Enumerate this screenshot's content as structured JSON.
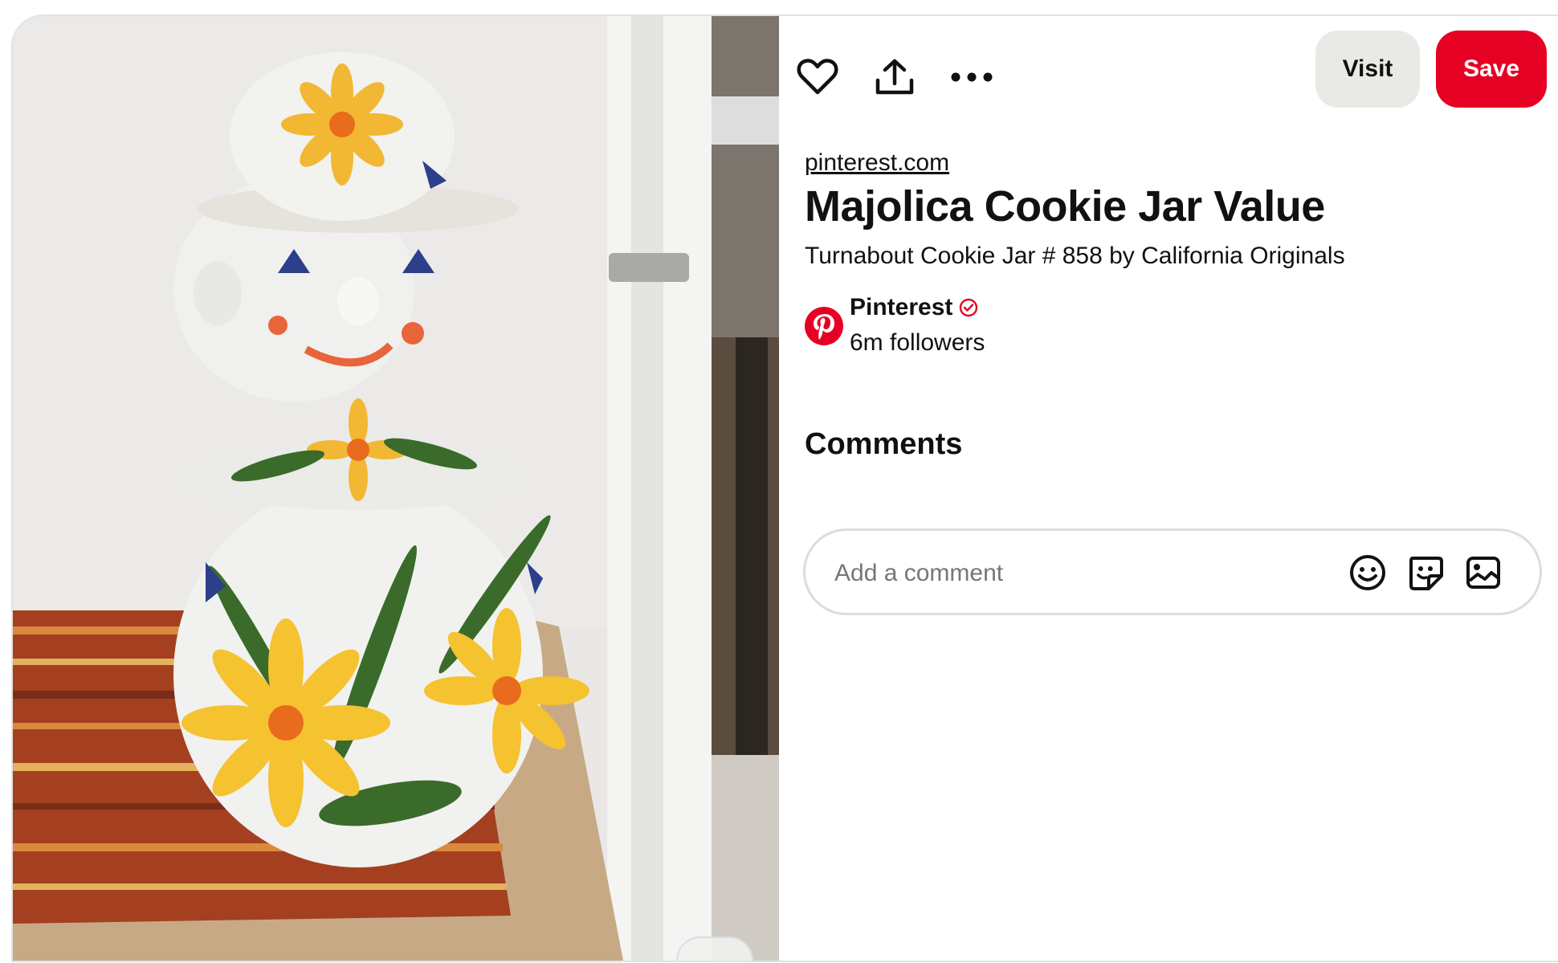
{
  "toolbar": {
    "like_icon": "heart-icon",
    "share_icon": "share-upload-icon",
    "more_icon": "ellipsis-icon",
    "visit_label": "Visit",
    "save_label": "Save"
  },
  "pin": {
    "source": "pinterest.com",
    "title": "Majolica Cookie Jar Value",
    "description": "Turnabout Cookie Jar # 858 by California Originals",
    "image_subject": "clown-cookie-jar-photo"
  },
  "creator": {
    "name": "Pinterest",
    "followers": "6m followers",
    "avatar_icon": "pinterest-logo-icon",
    "verified_icon": "verified-check-icon"
  },
  "comments": {
    "heading": "Comments",
    "placeholder": "Add a comment",
    "emoji_icon": "emoji-icon",
    "sticker_icon": "sticker-icon",
    "image_icon": "image-icon"
  },
  "colors": {
    "save_button": "#e60023",
    "visit_button": "#e9e9e6",
    "text": "#111111",
    "placeholder": "#767676",
    "brand": "#e60023"
  }
}
